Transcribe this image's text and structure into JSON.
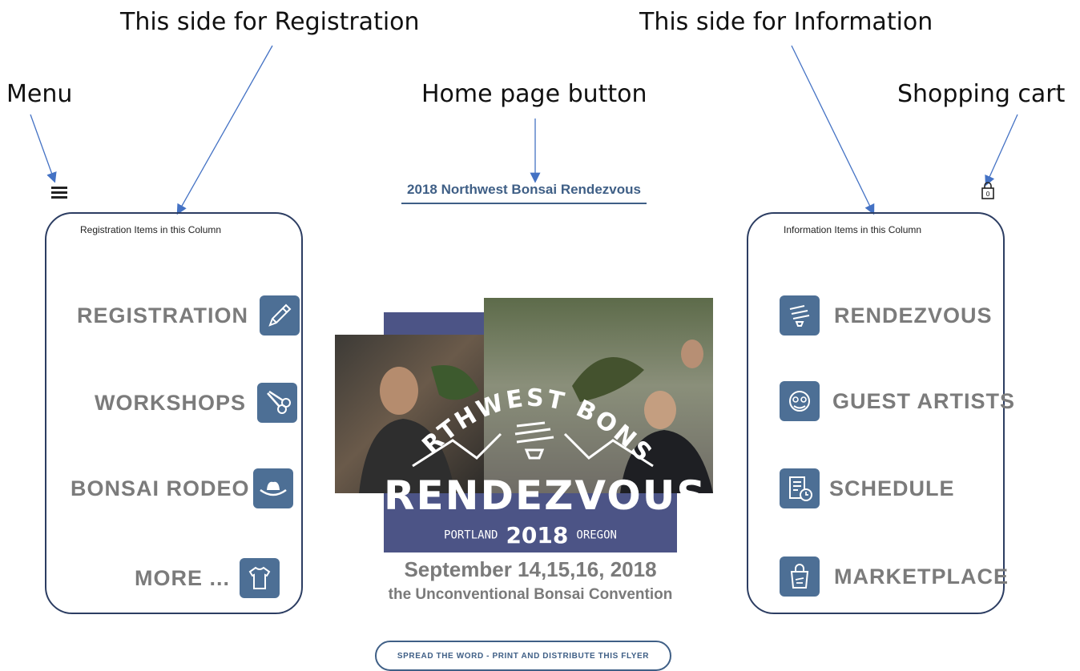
{
  "annotations": {
    "registration_side": "This side for Registration",
    "information_side": "This side for Information",
    "menu": "Menu",
    "home_button": "Home page button",
    "shopping_cart": "Shopping cart"
  },
  "header": {
    "title": "2018 Northwest Bonsai Rendezvous",
    "cart_count": "0"
  },
  "left_column": {
    "caption": "Registration Items in this Column",
    "items": [
      {
        "label": "REGISTRATION",
        "icon": "pencil-icon"
      },
      {
        "label": "WORKSHOPS",
        "icon": "scissors-icon"
      },
      {
        "label": "BONSAI RODEO",
        "icon": "cowboy-hat-icon"
      },
      {
        "label": "MORE ...",
        "icon": "tshirt-icon"
      }
    ]
  },
  "right_column": {
    "caption": "Information Items in this Column",
    "items": [
      {
        "label": "RENDEZVOUS",
        "icon": "bonsai-logo-icon"
      },
      {
        "label": "GUEST ARTISTS",
        "icon": "artist-face-icon"
      },
      {
        "label": "SCHEDULE",
        "icon": "schedule-clock-icon"
      },
      {
        "label": "MARKETPLACE",
        "icon": "shopping-bag-icon"
      }
    ]
  },
  "poster": {
    "arc_text": "NORTHWEST BONSAI",
    "headline": "RENDEZVOUS",
    "city_left": "PORTLAND",
    "year": "2018",
    "city_right": "OREGON"
  },
  "event": {
    "dates": "September 14,15,16, 2018",
    "tagline": "the Unconventional Bonsai Convention"
  },
  "flyer_button": "SPREAD THE WORD - PRINT AND DISTRIBUTE THIS FLYER",
  "colors": {
    "accent": "#3f5f86",
    "tile": "#4d6f95",
    "frame": "#2c3d62",
    "arrow": "#4472c4",
    "poster_block": "#4c5486",
    "label_gray": "#7b7b7b"
  }
}
